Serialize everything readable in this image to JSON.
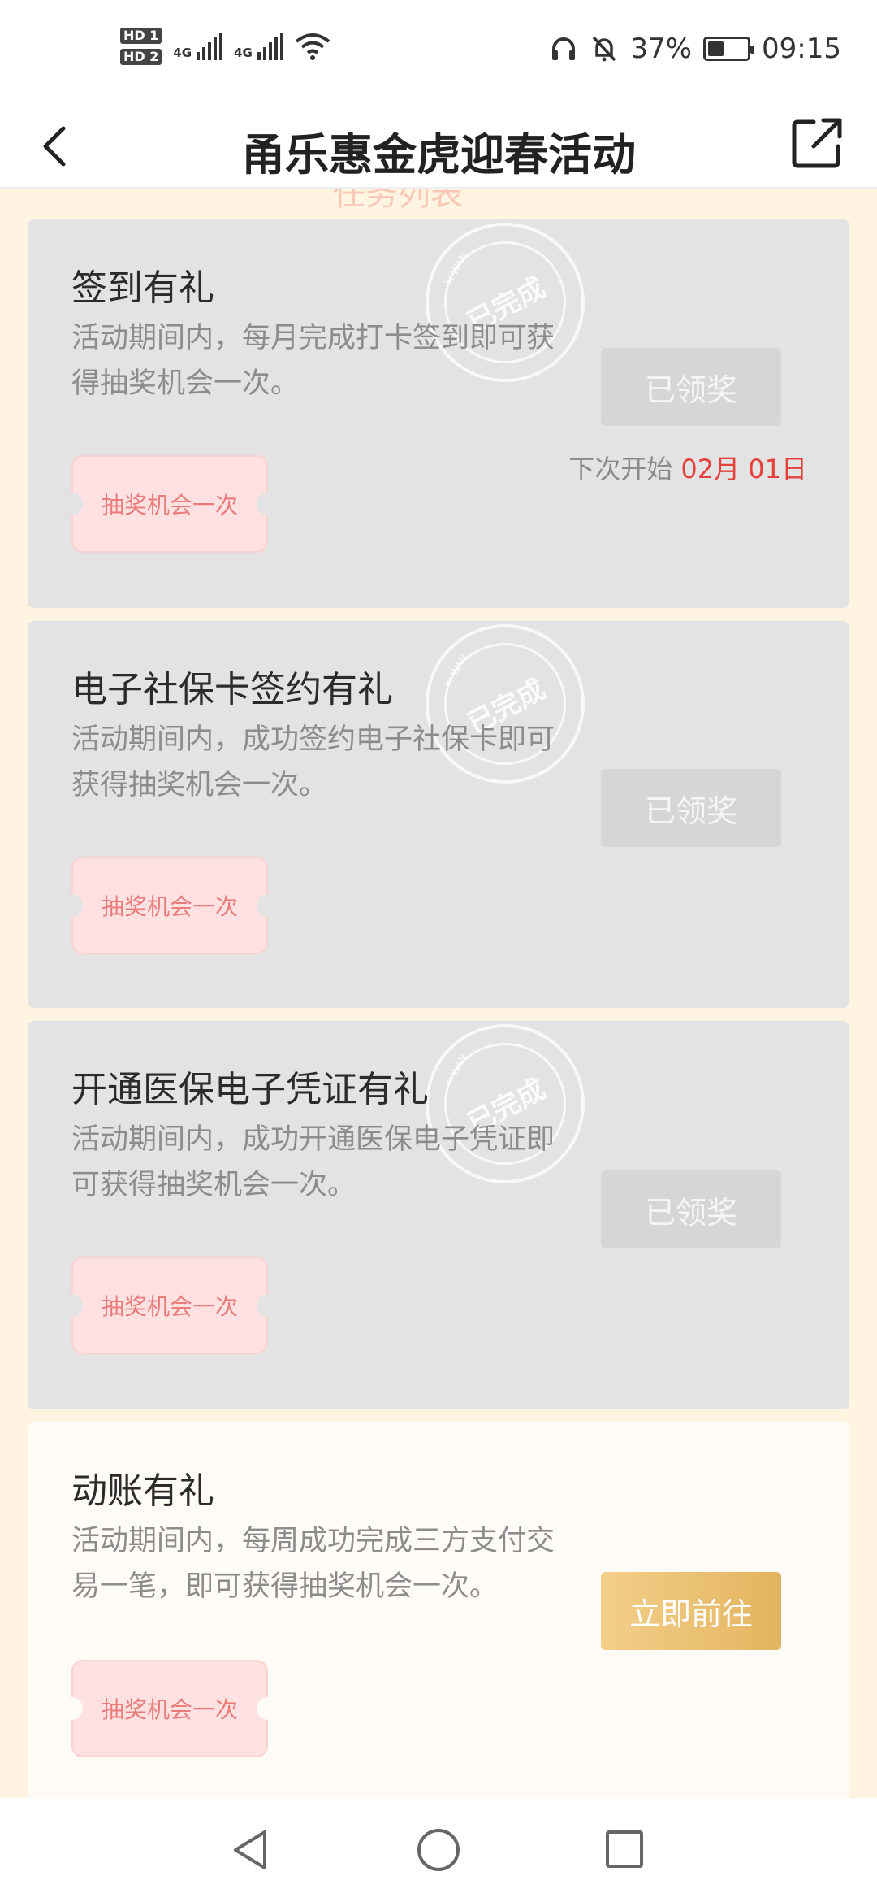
{
  "status_bar": {
    "hd1": "HD 1",
    "hd2": "HD 2",
    "net1": "4G",
    "net2": "4G",
    "battery": "37%",
    "battery_level": 0.37,
    "time": "09:15"
  },
  "header": {
    "title": "甬乐惠金虎迎春活动"
  },
  "peek_text": "任务列表",
  "tasks": [
    {
      "title": "签到有礼",
      "desc": "活动期间内，每月完成打卡签到即可获得抽奖机会一次。",
      "ticket": "抽奖机会一次",
      "button": "已领奖",
      "next_label": "下次开始",
      "next_date": "02月 01日",
      "stamp": "已完成"
    },
    {
      "title": "电子社保卡签约有礼",
      "desc": "活动期间内，成功签约电子社保卡即可获得抽奖机会一次。",
      "ticket": "抽奖机会一次",
      "button": "已领奖",
      "stamp": "已完成"
    },
    {
      "title": "开通医保电子凭证有礼",
      "desc": "活动期间内，成功开通医保电子凭证即可获得抽奖机会一次。",
      "ticket": "抽奖机会一次",
      "button": "已领奖",
      "stamp": "已完成"
    },
    {
      "title": "动账有礼",
      "desc": "活动期间内，每周成功完成三方支付交易一笔，即可获得抽奖机会一次。",
      "ticket": "抽奖机会一次",
      "button": "立即前往"
    }
  ],
  "stamp_ring_text": "YI WAN",
  "colors": {
    "page_bg": "#fff3e2",
    "done_card": "#e4e3e3",
    "active_card": "#fffbf6",
    "accent_gold": "#e3b45f",
    "date_red": "#e5413c",
    "ticket_text": "#ea7b7b"
  }
}
